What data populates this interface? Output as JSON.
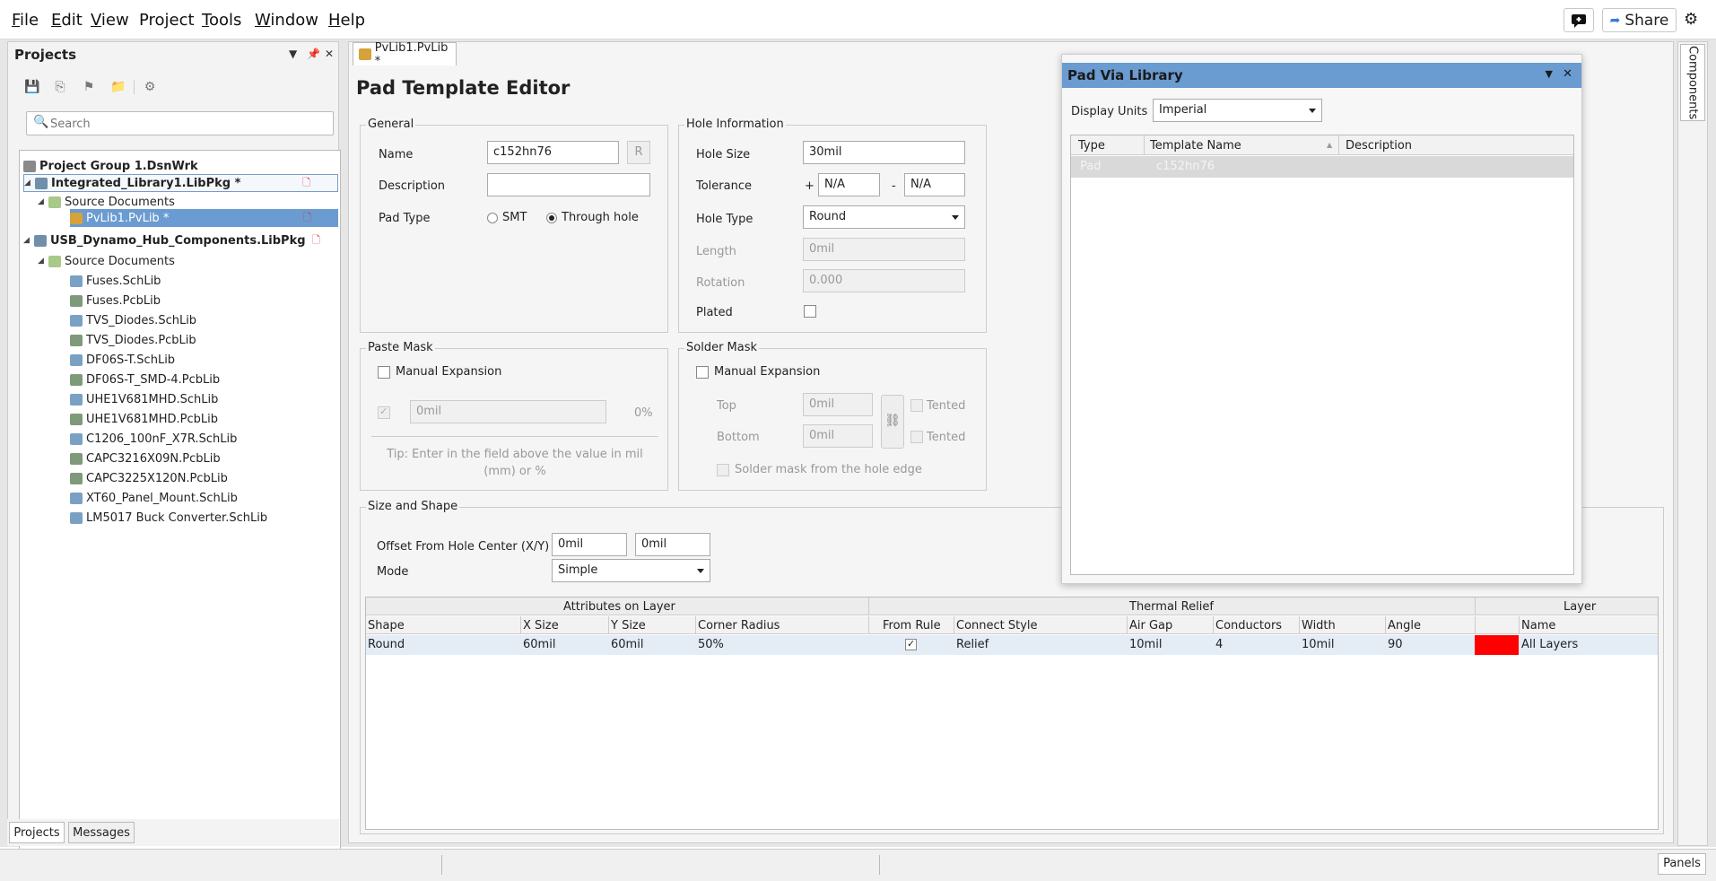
{
  "menu": {
    "items": [
      {
        "key": "F",
        "rest": "ile"
      },
      {
        "key": "E",
        "rest": "dit"
      },
      {
        "key": "V",
        "rest": "iew"
      },
      {
        "key": "",
        "rest": "Project"
      },
      {
        "key": "T",
        "rest": "ools"
      },
      {
        "key": "W",
        "rest": "indow"
      },
      {
        "key": "H",
        "rest": "elp"
      }
    ],
    "share_label": "Share"
  },
  "projects_panel": {
    "title": "Projects",
    "search_placeholder": "Search",
    "tree": [
      {
        "label": "Project Group 1.DsnWrk",
        "level": 0,
        "bold": true
      },
      {
        "label": "Integrated_Library1.LibPkg *",
        "level": 1,
        "bold": true
      },
      {
        "label": "Source Documents",
        "level": 2
      },
      {
        "label": "PvLib1.PvLib *",
        "level": 3,
        "selected": true
      },
      {
        "label": "USB_Dynamo_Hub_Components.LibPkg",
        "level": 1,
        "bold": true
      },
      {
        "label": "Source Documents",
        "level": 2
      },
      {
        "label": "Fuses.SchLib",
        "level": 3
      },
      {
        "label": "Fuses.PcbLib",
        "level": 3
      },
      {
        "label": "TVS_Diodes.SchLib",
        "level": 3
      },
      {
        "label": "TVS_Diodes.PcbLib",
        "level": 3
      },
      {
        "label": "DF06S-T.SchLib",
        "level": 3
      },
      {
        "label": "DF06S-T_SMD-4.PcbLib",
        "level": 3
      },
      {
        "label": "UHE1V681MHD.SchLib",
        "level": 3
      },
      {
        "label": "UHE1V681MHD.PcbLib",
        "level": 3
      },
      {
        "label": "C1206_100nF_X7R.SchLib",
        "level": 3
      },
      {
        "label": "CAPC3216X09N.PcbLib",
        "level": 3
      },
      {
        "label": "CAPC3225X120N.PcbLib",
        "level": 3
      },
      {
        "label": "XT60_Panel_Mount.SchLib",
        "level": 3
      },
      {
        "label": "LM5017 Buck Converter.SchLib",
        "level": 3
      }
    ],
    "tabs": [
      "Projects",
      "Messages"
    ]
  },
  "document": {
    "tab_label": "PvLib1.PvLib *",
    "title": "Pad Template Editor",
    "general": {
      "title": "General",
      "name_label": "Name",
      "name_value": "c152hn76",
      "r_button": "R",
      "description_label": "Description",
      "description_value": "",
      "pad_type_label": "Pad Type",
      "smt_label": "SMT",
      "through_hole_label": "Through hole"
    },
    "hole": {
      "title": "Hole Information",
      "hole_size_label": "Hole Size",
      "hole_size_value": "30mil",
      "tolerance_label": "Tolerance",
      "plus": "+",
      "minus": "-",
      "tol_plus_value": "N/A",
      "tol_minus_value": "N/A",
      "hole_type_label": "Hole Type",
      "hole_type_value": "Round",
      "length_label": "Length",
      "length_value": "0mil",
      "rotation_label": "Rotation",
      "rotation_value": "0.000",
      "plated_label": "Plated"
    },
    "paste": {
      "title": "Paste Mask",
      "manual_label": "Manual Expansion",
      "value": "0mil",
      "percent": "0%",
      "tip": "Tip: Enter in the field above the value in mil (mm) or %"
    },
    "solder": {
      "title": "Solder Mask",
      "manual_label": "Manual Expansion",
      "top_label": "Top",
      "top_value": "0mil",
      "bottom_label": "Bottom",
      "bottom_value": "0mil",
      "tented_label": "Tented",
      "from_hole_label": "Solder mask from the hole edge"
    },
    "size_shape": {
      "title": "Size and Shape",
      "offset_label": "Offset From Hole Center (X/Y)",
      "offset_x": "0mil",
      "offset_y": "0mil",
      "mode_label": "Mode",
      "mode_value": "Simple"
    },
    "table": {
      "group_headers": [
        "Attributes on Layer",
        "Thermal Relief",
        "Layer"
      ],
      "columns": [
        "Shape",
        "X Size",
        "Y Size",
        "Corner Radius",
        "From Rule",
        "Connect Style",
        "Air Gap",
        "Conductors",
        "Width",
        "Angle",
        "",
        "Name"
      ],
      "rows": [
        [
          "Round",
          "60mil",
          "60mil",
          "50%",
          "",
          "Relief",
          "10mil",
          "4",
          "10mil",
          "90",
          "",
          "All Layers"
        ]
      ],
      "layer_color": "#ff0000"
    }
  },
  "dialog": {
    "title": "Pad Via Library",
    "units_label": "Display Units",
    "units_value": "Imperial",
    "columns": [
      "Type",
      "Template Name",
      "Description"
    ],
    "rows": [
      [
        "Pad",
        "c152hn76",
        ""
      ]
    ]
  },
  "right_panel": {
    "tab": "Components"
  },
  "status": {
    "panels_label": "Panels"
  },
  "colors": {
    "selection": "#6a9bd1",
    "title_bar": "#6a9bd1"
  }
}
